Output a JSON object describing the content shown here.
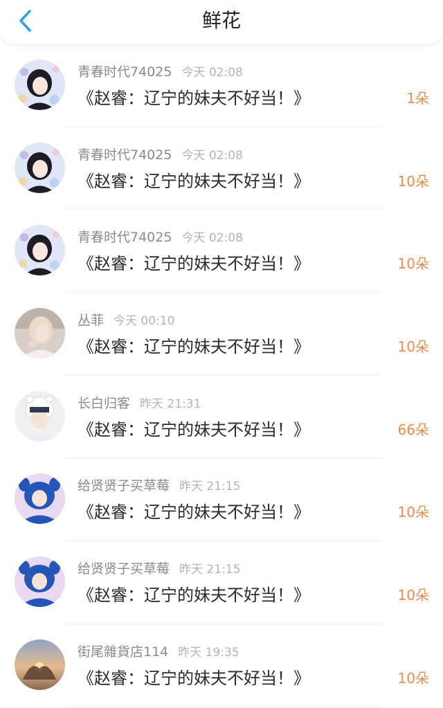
{
  "header": {
    "title": "鲜花",
    "back_icon": "chevron-left-icon",
    "accent_color": "#2aa0f0"
  },
  "count_color": "#f28a45",
  "items": [
    {
      "username": "青春时代74025",
      "time": "今天 02:08",
      "content": "《赵睿：辽宁的妹夫不好当！》",
      "count": "1朵",
      "avatar": "avatar-anime-girl"
    },
    {
      "username": "青春时代74025",
      "time": "今天 02:08",
      "content": "《赵睿：辽宁的妹夫不好当！》",
      "count": "10朵",
      "avatar": "avatar-anime-girl"
    },
    {
      "username": "青春时代74025",
      "time": "今天 02:08",
      "content": "《赵睿：辽宁的妹夫不好当！》",
      "count": "10朵",
      "avatar": "avatar-anime-girl"
    },
    {
      "username": "丛菲",
      "time": "今天 00:10",
      "content": "《赵睿：辽宁的妹夫不好当！》",
      "count": "10朵",
      "avatar": "avatar-blonde-girl"
    },
    {
      "username": "长白归客",
      "time": "昨天 21:31",
      "content": "《赵睿：辽宁的妹夫不好当！》",
      "count": "66朵",
      "avatar": "avatar-child-hat"
    },
    {
      "username": "给贤贤子买草莓",
      "time": "昨天 21:15",
      "content": "《赵睿：辽宁的妹夫不好当！》",
      "count": "10朵",
      "avatar": "avatar-blue-hoodie"
    },
    {
      "username": "给贤贤子买草莓",
      "time": "昨天 21:15",
      "content": "《赵睿：辽宁的妹夫不好当！》",
      "count": "10朵",
      "avatar": "avatar-blue-hoodie"
    },
    {
      "username": "街尾雜貨店114",
      "time": "昨天 19:35",
      "content": "《赵睿：辽宁的妹夫不好当！》",
      "count": "10朵",
      "avatar": "avatar-sunset-hands"
    }
  ]
}
